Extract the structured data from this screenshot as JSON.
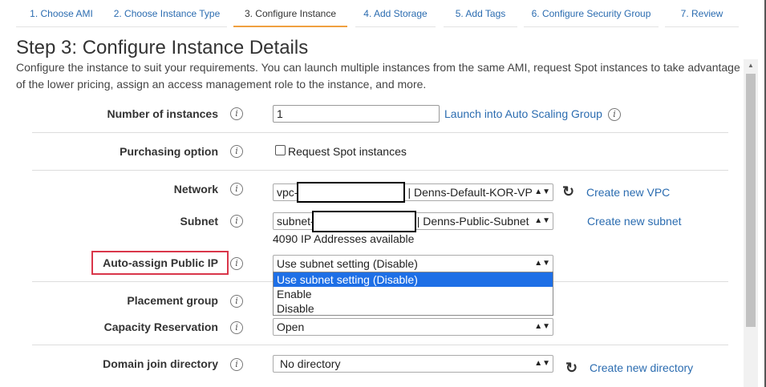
{
  "tabs": [
    {
      "label": "1. Choose AMI"
    },
    {
      "label": "2. Choose Instance Type"
    },
    {
      "label": "3. Configure Instance"
    },
    {
      "label": "4. Add Storage"
    },
    {
      "label": "5. Add Tags"
    },
    {
      "label": "6. Configure Security Group"
    },
    {
      "label": "7. Review"
    }
  ],
  "active_tab": "3. Configure Instance",
  "page": {
    "title": "Step 3: Configure Instance Details",
    "description": "Configure the instance to suit your requirements. You can launch multiple instances from the same AMI, request Spot instances to take advantage of the lower pricing, assign an access management role to the instance, and more."
  },
  "form": {
    "number_of_instances": {
      "label": "Number of instances",
      "value": "1",
      "link": "Launch into Auto Scaling Group"
    },
    "purchasing_option": {
      "label": "Purchasing option",
      "checkbox_label": "Request Spot instances",
      "checked": false
    },
    "network": {
      "label": "Network",
      "prefix": "vpc-",
      "suffix": "| Denns-Default-KOR-VPC",
      "link": "Create new VPC"
    },
    "subnet": {
      "label": "Subnet",
      "prefix": "subnet-",
      "suffix": "| Denns-Public-Subnet |",
      "info": "4090 IP Addresses available",
      "link": "Create new subnet"
    },
    "auto_assign_ip": {
      "label": "Auto-assign Public IP",
      "selected": "Use subnet setting (Disable)",
      "options": [
        "Use subnet setting (Disable)",
        "Enable",
        "Disable"
      ],
      "open": true
    },
    "placement_group": {
      "label": "Placement group"
    },
    "capacity_reservation": {
      "label": "Capacity Reservation",
      "selected": "Open"
    },
    "domain_join": {
      "label": "Domain join directory",
      "selected": "No directory",
      "link": "Create new directory"
    }
  },
  "colors": {
    "accent": "#f0a040",
    "link": "#2b6cb0",
    "highlight": "#d9364a",
    "selected_option": "#1e6fe6"
  }
}
